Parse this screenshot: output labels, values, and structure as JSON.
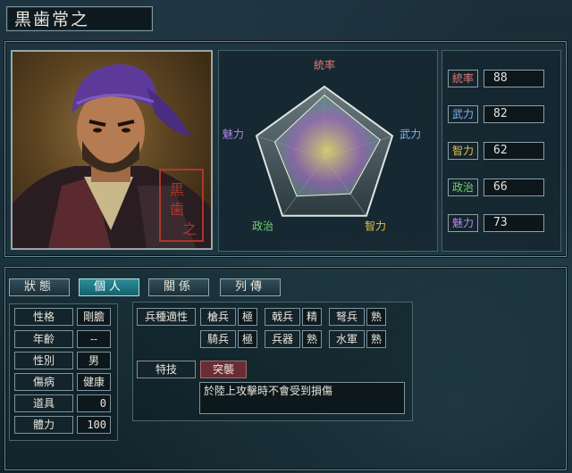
{
  "officer": {
    "name": "黒歯常之"
  },
  "radar": {
    "labels": [
      "統率",
      "武力",
      "智力",
      "政治",
      "魅力"
    ],
    "values": [
      88,
      82,
      62,
      66,
      73
    ],
    "max": 100
  },
  "stats": [
    {
      "label": "統率",
      "value": "88",
      "color": "#e07878"
    },
    {
      "label": "武力",
      "value": "82",
      "color": "#7fb3f0"
    },
    {
      "label": "智力",
      "value": "62",
      "color": "#e8c040"
    },
    {
      "label": "政治",
      "value": "66",
      "color": "#70d070"
    },
    {
      "label": "魅力",
      "value": "73",
      "color": "#b48ae8"
    }
  ],
  "tabs": [
    "狀態",
    "個人",
    "關係",
    "列傳"
  ],
  "active_tab": "個人",
  "personal": [
    {
      "label": "性格",
      "value": "剛膽"
    },
    {
      "label": "年齡",
      "value": "--"
    },
    {
      "label": "性別",
      "value": "男"
    },
    {
      "label": "傷病",
      "value": "健康"
    },
    {
      "label": "道具",
      "value": "0"
    },
    {
      "label": "體力",
      "value": "100"
    }
  ],
  "aptitude": {
    "header": "兵種適性",
    "rows": [
      [
        {
          "unit": "槍兵",
          "grade": "極"
        },
        {
          "unit": "戟兵",
          "grade": "精"
        },
        {
          "unit": "弩兵",
          "grade": "熟"
        }
      ],
      [
        {
          "unit": "騎兵",
          "grade": "極"
        },
        {
          "unit": "兵器",
          "grade": "熟"
        },
        {
          "unit": "水軍",
          "grade": "熟"
        }
      ]
    ]
  },
  "skill": {
    "header": "特技",
    "name": "突襲",
    "description": "於陸上攻擊時不會受到損傷"
  }
}
